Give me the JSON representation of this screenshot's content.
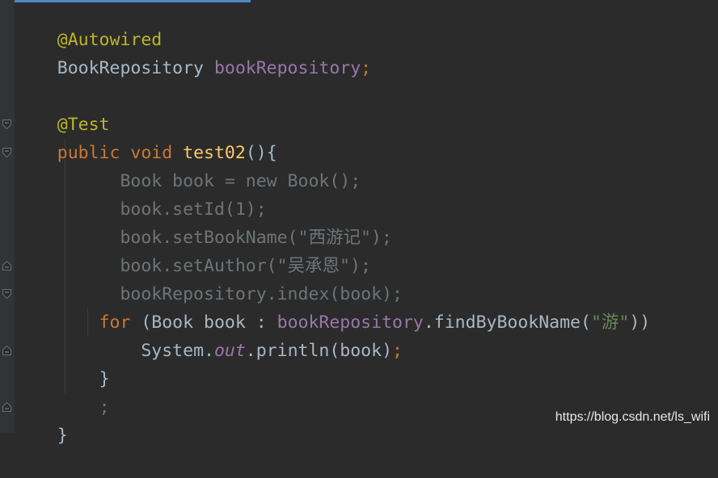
{
  "editor": {
    "lines": {
      "l1": {
        "annotation": "@Autowired"
      },
      "l2": {
        "type": "BookRepository",
        "space": " ",
        "field": "bookRepository",
        "semi": ";"
      },
      "l4": {
        "annotation": "@Test"
      },
      "l5": {
        "kw_public": "public",
        "sp1": " ",
        "kw_void": "void",
        "sp2": " ",
        "method": "test02",
        "rest": "(){"
      },
      "l6": {
        "indent": "      ",
        "code": "Book book = new Book();"
      },
      "l7": {
        "indent": "      ",
        "code": "book.setId(1);"
      },
      "l8": {
        "indent": "      ",
        "code": "book.setBookName(\"西游记\");"
      },
      "l9": {
        "indent": "      ",
        "code": "book.setAuthor(\"吴承恩\");"
      },
      "l10": {
        "indent": "      ",
        "code": "bookRepository.index(book);"
      },
      "l11": {
        "indent": "    ",
        "kw_for": "for",
        "part1": " (Book book : ",
        "field": "bookRepository",
        "part2": ".findByBookName(",
        "string": "\"游\"",
        "part3": "))"
      },
      "l12": {
        "indent": "        ",
        "sys": "System.",
        "out": "out",
        "println": ".println(book)",
        "semi": ";"
      },
      "l13": {
        "indent": "    ",
        "brace": "}"
      },
      "l14": {
        "indent": "    ",
        "semi": ";"
      },
      "l15": {
        "brace": "}"
      }
    },
    "colors": {
      "background": "#2b2b2b",
      "gutter": "#313335",
      "annotation": "#bbb529",
      "keyword": "#cc7832",
      "field": "#9876aa",
      "method_declaration": "#ffc66d",
      "string": "#6a8759",
      "default_text": "#a9b7c6",
      "unused_code": "#6e7478"
    },
    "icons": [
      "fold-open-icon",
      "fold-close-icon"
    ]
  },
  "watermark": {
    "text": "https://blog.csdn.net/ls_wifi"
  }
}
